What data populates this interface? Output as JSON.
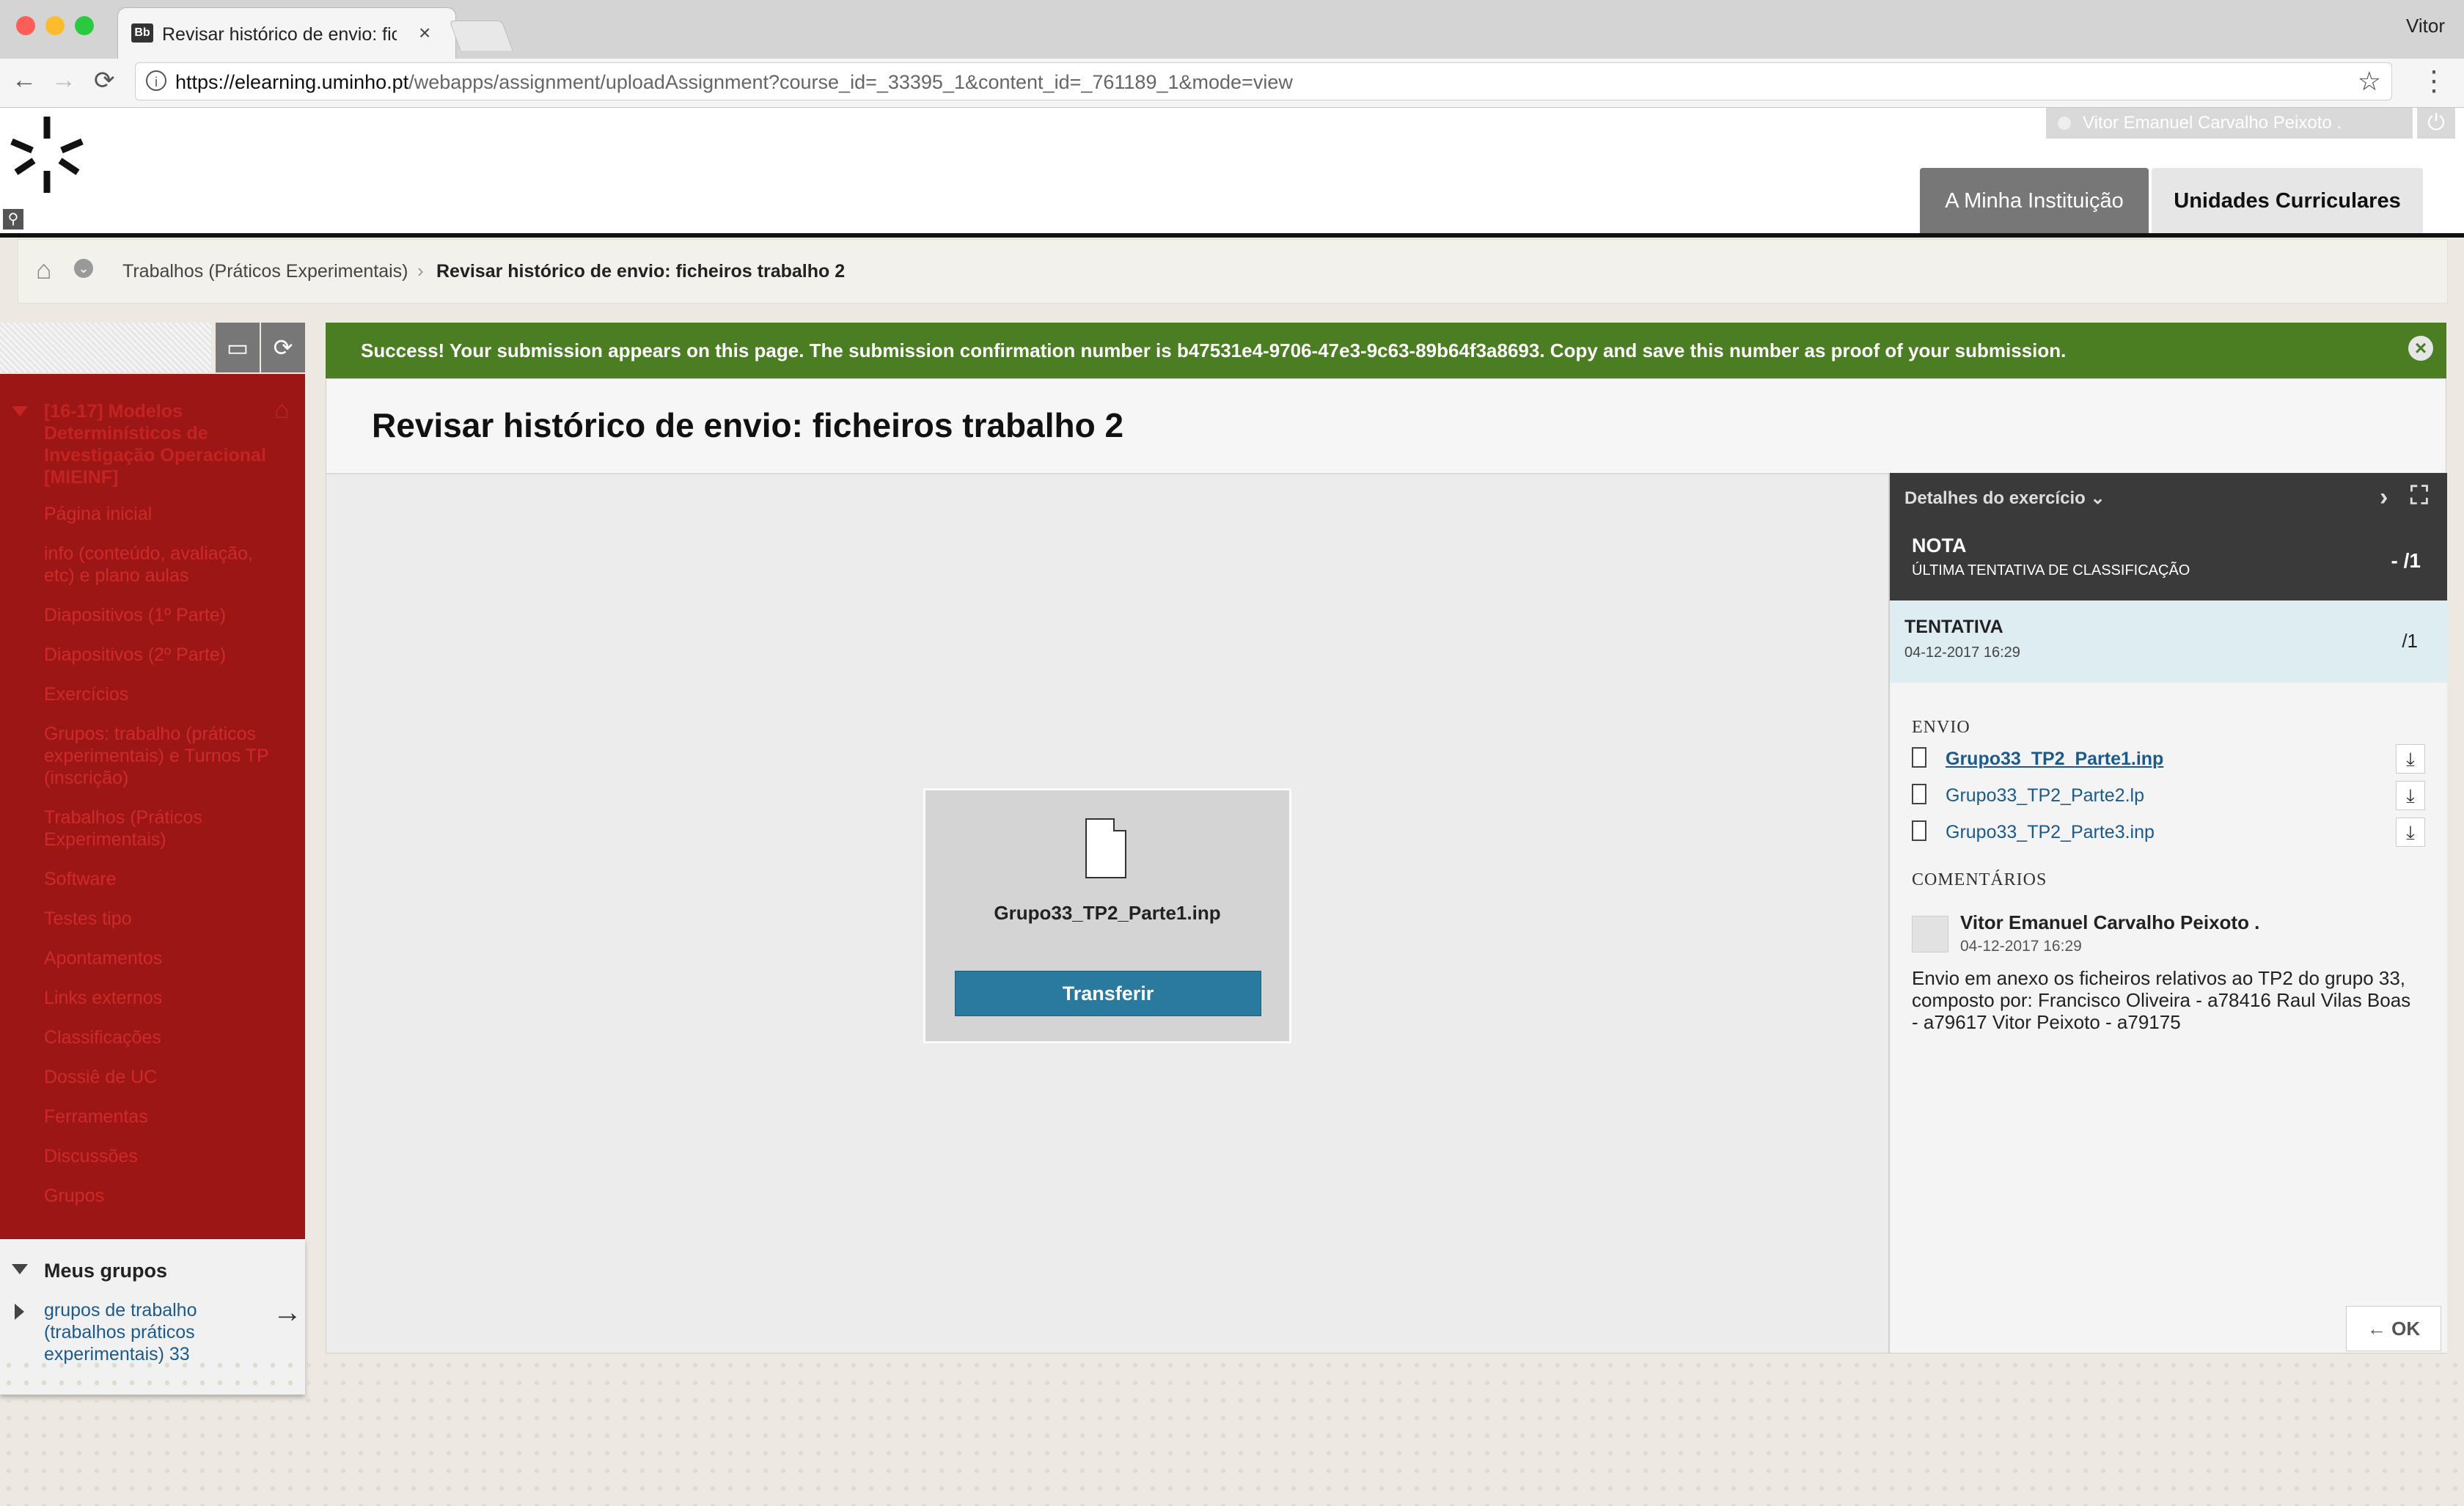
{
  "browser": {
    "tab_title": "Revisar histórico de envio: fich",
    "tab_favicon": "Bb",
    "close_glyph": "×",
    "user_name": "Vitor",
    "url_host": "https://elearning.uminho.pt",
    "url_path": "/webapps/assignment/uploadAssignment?course_id=_33395_1&content_id=_761189_1&mode=view"
  },
  "header": {
    "user_display": "Vitor Emanuel Carvalho Peixoto .",
    "tabs": [
      "A Minha Instituição",
      "Unidades Curriculares"
    ]
  },
  "breadcrumb": {
    "parent": "Trabalhos (Práticos Experimentais)",
    "current": "Revisar histórico de envio: ficheiros trabalho 2"
  },
  "left_menu": {
    "course_title": "[16-17] Modelos Determinísticos de Investigação Operacional [MIEINF]",
    "items": [
      "Página inicial",
      "info (conteúdo, avaliação, etc) e plano aulas",
      "Diapositivos (1º Parte)",
      "Diapositivos (2º Parte)",
      "Exercícios",
      "Grupos: trabalho (práticos experimentais) e Turnos TP (inscrição)",
      "Trabalhos (Práticos Experimentais)",
      "Software",
      "Testes tipo",
      "Apontamentos",
      "Links externos",
      "Classificações",
      "Dossiê de UC",
      "Ferramentas",
      "Discussões",
      "Grupos"
    ],
    "groups_heading": "Meus grupos",
    "group_link": "grupos de trabalho (trabalhos práticos experimentais) 33",
    "colors": {
      "menu_bg": "#9c1616",
      "menu_text": "#cf2a2a"
    }
  },
  "success": {
    "message": "Success! Your submission appears on this page. The submission confirmation number is b47531e4-9706-47e3-9c63-89b64f3a8693. Copy and save this number as proof of your submission.",
    "color": "#4b7d22"
  },
  "page": {
    "title": "Revisar histórico de envio: ficheiros trabalho 2"
  },
  "preview": {
    "filename": "Grupo33_TP2_Parte1.inp",
    "download_button": "Transferir"
  },
  "details": {
    "heading": "Detalhes do exercício",
    "grade": {
      "label": "NOTA",
      "sub": "ÚLTIMA TENTATIVA DE CLASSIFICAÇÃO",
      "value": "- /1"
    },
    "attempt": {
      "label": "TENTATIVA",
      "date": "04-12-2017 16:29",
      "value": "/1"
    },
    "submission_heading": "ENVIO",
    "files": [
      "Grupo33_TP2_Parte1.inp",
      "Grupo33_TP2_Parte2.lp",
      "Grupo33_TP2_Parte3.inp"
    ],
    "comments_heading": "COMENTÁRIOS",
    "comment": {
      "author": "Vitor Emanuel Carvalho Peixoto .",
      "date": "04-12-2017 16:29",
      "text": "Envio em anexo os ficheiros relativos ao TP2 do grupo 33, composto por: Francisco Oliveira - a78416 Raul Vilas Boas - a79617 Vitor Peixoto - a79175"
    },
    "ok_button": "← OK"
  },
  "icons": {
    "back": "←",
    "forward": "→",
    "reload": "⟳",
    "star": "☆",
    "menu": "⋮",
    "home": "⌂",
    "download": "⤓",
    "chevron_right": "›",
    "expand": "⛶",
    "arrow_right": "→"
  }
}
